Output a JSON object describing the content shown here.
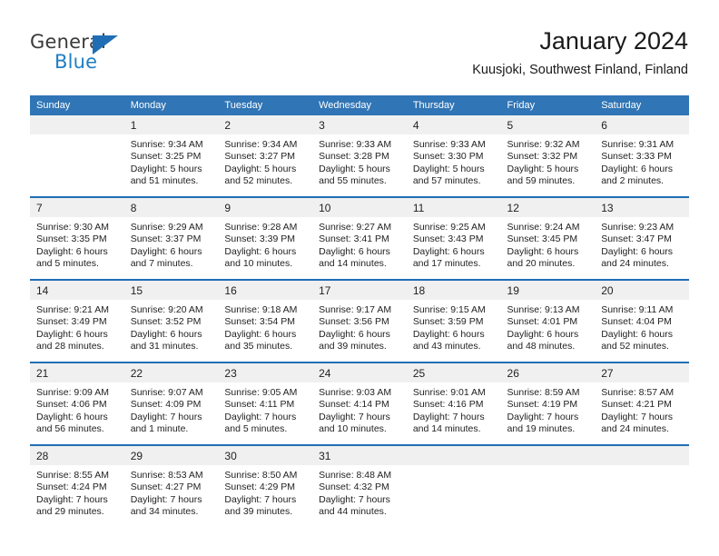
{
  "logo": {
    "word1": "General",
    "word2": "Blue",
    "triangle_color": "#1f6eb5",
    "blue_text_color": "#1f7ec4"
  },
  "header": {
    "title": "January 2024",
    "subtitle": "Kuusjoki, Southwest Finland, Finland"
  },
  "theme": {
    "header_row_bg": "#3075b5",
    "daynum_bg": "#f0f0f0",
    "week_divider": "#1f6eb5"
  },
  "weekdays": [
    "Sunday",
    "Monday",
    "Tuesday",
    "Wednesday",
    "Thursday",
    "Friday",
    "Saturday"
  ],
  "weeks": [
    [
      {
        "day": "",
        "lines": []
      },
      {
        "day": "1",
        "lines": [
          "Sunrise: 9:34 AM",
          "Sunset: 3:25 PM",
          "Daylight: 5 hours",
          "and 51 minutes."
        ]
      },
      {
        "day": "2",
        "lines": [
          "Sunrise: 9:34 AM",
          "Sunset: 3:27 PM",
          "Daylight: 5 hours",
          "and 52 minutes."
        ]
      },
      {
        "day": "3",
        "lines": [
          "Sunrise: 9:33 AM",
          "Sunset: 3:28 PM",
          "Daylight: 5 hours",
          "and 55 minutes."
        ]
      },
      {
        "day": "4",
        "lines": [
          "Sunrise: 9:33 AM",
          "Sunset: 3:30 PM",
          "Daylight: 5 hours",
          "and 57 minutes."
        ]
      },
      {
        "day": "5",
        "lines": [
          "Sunrise: 9:32 AM",
          "Sunset: 3:32 PM",
          "Daylight: 5 hours",
          "and 59 minutes."
        ]
      },
      {
        "day": "6",
        "lines": [
          "Sunrise: 9:31 AM",
          "Sunset: 3:33 PM",
          "Daylight: 6 hours",
          "and 2 minutes."
        ]
      }
    ],
    [
      {
        "day": "7",
        "lines": [
          "Sunrise: 9:30 AM",
          "Sunset: 3:35 PM",
          "Daylight: 6 hours",
          "and 5 minutes."
        ]
      },
      {
        "day": "8",
        "lines": [
          "Sunrise: 9:29 AM",
          "Sunset: 3:37 PM",
          "Daylight: 6 hours",
          "and 7 minutes."
        ]
      },
      {
        "day": "9",
        "lines": [
          "Sunrise: 9:28 AM",
          "Sunset: 3:39 PM",
          "Daylight: 6 hours",
          "and 10 minutes."
        ]
      },
      {
        "day": "10",
        "lines": [
          "Sunrise: 9:27 AM",
          "Sunset: 3:41 PM",
          "Daylight: 6 hours",
          "and 14 minutes."
        ]
      },
      {
        "day": "11",
        "lines": [
          "Sunrise: 9:25 AM",
          "Sunset: 3:43 PM",
          "Daylight: 6 hours",
          "and 17 minutes."
        ]
      },
      {
        "day": "12",
        "lines": [
          "Sunrise: 9:24 AM",
          "Sunset: 3:45 PM",
          "Daylight: 6 hours",
          "and 20 minutes."
        ]
      },
      {
        "day": "13",
        "lines": [
          "Sunrise: 9:23 AM",
          "Sunset: 3:47 PM",
          "Daylight: 6 hours",
          "and 24 minutes."
        ]
      }
    ],
    [
      {
        "day": "14",
        "lines": [
          "Sunrise: 9:21 AM",
          "Sunset: 3:49 PM",
          "Daylight: 6 hours",
          "and 28 minutes."
        ]
      },
      {
        "day": "15",
        "lines": [
          "Sunrise: 9:20 AM",
          "Sunset: 3:52 PM",
          "Daylight: 6 hours",
          "and 31 minutes."
        ]
      },
      {
        "day": "16",
        "lines": [
          "Sunrise: 9:18 AM",
          "Sunset: 3:54 PM",
          "Daylight: 6 hours",
          "and 35 minutes."
        ]
      },
      {
        "day": "17",
        "lines": [
          "Sunrise: 9:17 AM",
          "Sunset: 3:56 PM",
          "Daylight: 6 hours",
          "and 39 minutes."
        ]
      },
      {
        "day": "18",
        "lines": [
          "Sunrise: 9:15 AM",
          "Sunset: 3:59 PM",
          "Daylight: 6 hours",
          "and 43 minutes."
        ]
      },
      {
        "day": "19",
        "lines": [
          "Sunrise: 9:13 AM",
          "Sunset: 4:01 PM",
          "Daylight: 6 hours",
          "and 48 minutes."
        ]
      },
      {
        "day": "20",
        "lines": [
          "Sunrise: 9:11 AM",
          "Sunset: 4:04 PM",
          "Daylight: 6 hours",
          "and 52 minutes."
        ]
      }
    ],
    [
      {
        "day": "21",
        "lines": [
          "Sunrise: 9:09 AM",
          "Sunset: 4:06 PM",
          "Daylight: 6 hours",
          "and 56 minutes."
        ]
      },
      {
        "day": "22",
        "lines": [
          "Sunrise: 9:07 AM",
          "Sunset: 4:09 PM",
          "Daylight: 7 hours",
          "and 1 minute."
        ]
      },
      {
        "day": "23",
        "lines": [
          "Sunrise: 9:05 AM",
          "Sunset: 4:11 PM",
          "Daylight: 7 hours",
          "and 5 minutes."
        ]
      },
      {
        "day": "24",
        "lines": [
          "Sunrise: 9:03 AM",
          "Sunset: 4:14 PM",
          "Daylight: 7 hours",
          "and 10 minutes."
        ]
      },
      {
        "day": "25",
        "lines": [
          "Sunrise: 9:01 AM",
          "Sunset: 4:16 PM",
          "Daylight: 7 hours",
          "and 14 minutes."
        ]
      },
      {
        "day": "26",
        "lines": [
          "Sunrise: 8:59 AM",
          "Sunset: 4:19 PM",
          "Daylight: 7 hours",
          "and 19 minutes."
        ]
      },
      {
        "day": "27",
        "lines": [
          "Sunrise: 8:57 AM",
          "Sunset: 4:21 PM",
          "Daylight: 7 hours",
          "and 24 minutes."
        ]
      }
    ],
    [
      {
        "day": "28",
        "lines": [
          "Sunrise: 8:55 AM",
          "Sunset: 4:24 PM",
          "Daylight: 7 hours",
          "and 29 minutes."
        ]
      },
      {
        "day": "29",
        "lines": [
          "Sunrise: 8:53 AM",
          "Sunset: 4:27 PM",
          "Daylight: 7 hours",
          "and 34 minutes."
        ]
      },
      {
        "day": "30",
        "lines": [
          "Sunrise: 8:50 AM",
          "Sunset: 4:29 PM",
          "Daylight: 7 hours",
          "and 39 minutes."
        ]
      },
      {
        "day": "31",
        "lines": [
          "Sunrise: 8:48 AM",
          "Sunset: 4:32 PM",
          "Daylight: 7 hours",
          "and 44 minutes."
        ]
      },
      {
        "day": "",
        "lines": []
      },
      {
        "day": "",
        "lines": []
      },
      {
        "day": "",
        "lines": []
      }
    ]
  ]
}
